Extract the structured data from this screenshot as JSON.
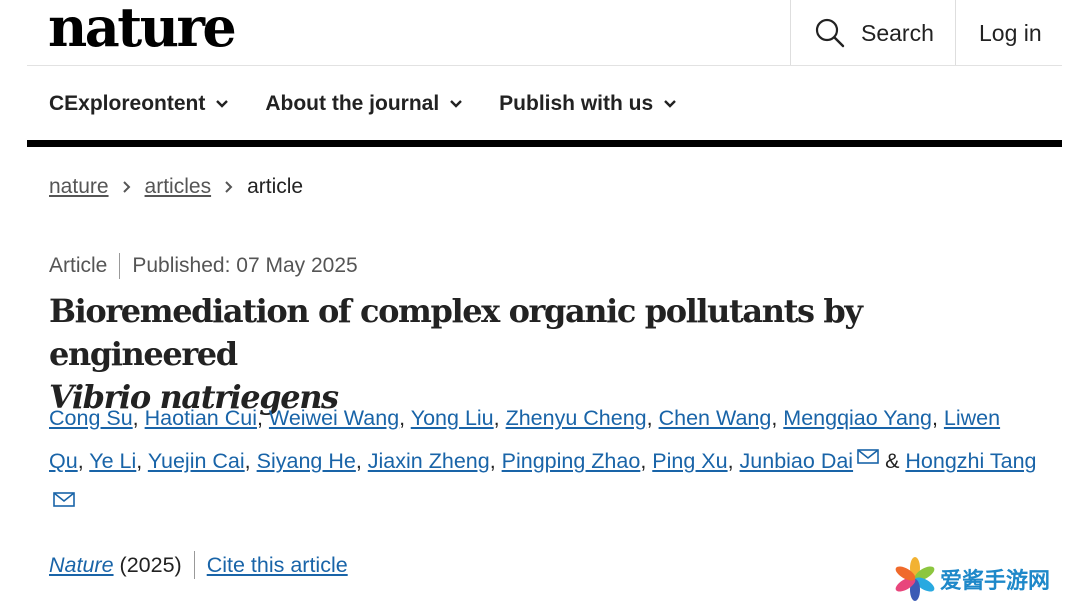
{
  "header": {
    "logo": "nature",
    "search_label": "Search",
    "login_label": "Log in"
  },
  "nav": {
    "items": [
      {
        "label": "CExploreontent"
      },
      {
        "label": "About the journal"
      },
      {
        "label": "Publish with us"
      }
    ]
  },
  "breadcrumb": {
    "items": [
      "nature",
      "articles"
    ],
    "current": "article"
  },
  "article": {
    "type": "Article",
    "published": "Published: 07 May 2025",
    "title_line1": "Bioremediation of complex organic pollutants by engineered",
    "title_line2": "Vibrio natriegens",
    "authors": [
      {
        "name": "Cong Su"
      },
      {
        "name": "Haotian Cui"
      },
      {
        "name": "Weiwei Wang"
      },
      {
        "name": "Yong Liu"
      },
      {
        "name": "Zhenyu Cheng"
      },
      {
        "name": "Chen Wang"
      },
      {
        "name": "Mengqiao Yang"
      },
      {
        "name": "Liwen Qu"
      },
      {
        "name": "Ye Li"
      },
      {
        "name": "Yuejin Cai"
      },
      {
        "name": "Siyang He"
      },
      {
        "name": "Jiaxin Zheng"
      },
      {
        "name": "Pingping Zhao"
      },
      {
        "name": "Ping Xu"
      },
      {
        "name": "Junbiao Dai",
        "contact_icon": "mail-icon"
      },
      {
        "name": "Hongzhi Tang",
        "contact_icon": "mail-icon"
      }
    ],
    "ampersand": "&",
    "journal": "Nature",
    "year": "(2025)",
    "cite_label": "Cite this article"
  },
  "watermark": {
    "text": "爱酱手游网",
    "icon": "pinwheel-logo-icon"
  },
  "colors": {
    "link": "#1964a8",
    "text": "#222222",
    "muted": "#555555",
    "rule": "#000000"
  }
}
